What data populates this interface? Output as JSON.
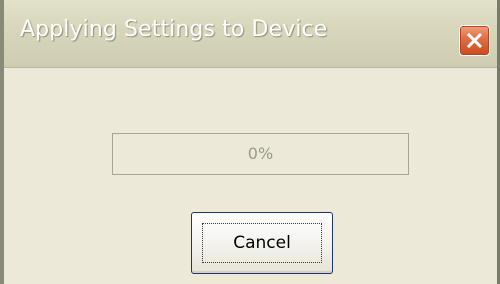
{
  "window": {
    "title": "Applying Settings to Device",
    "close_icon": "close-icon"
  },
  "progress": {
    "value_fraction": 0,
    "text": "0%",
    "fill_color": "#3c8f3c"
  },
  "buttons": {
    "cancel_label": "Cancel"
  },
  "colors": {
    "dialog_background": "#ece9d8",
    "close_button": "#e07048"
  }
}
